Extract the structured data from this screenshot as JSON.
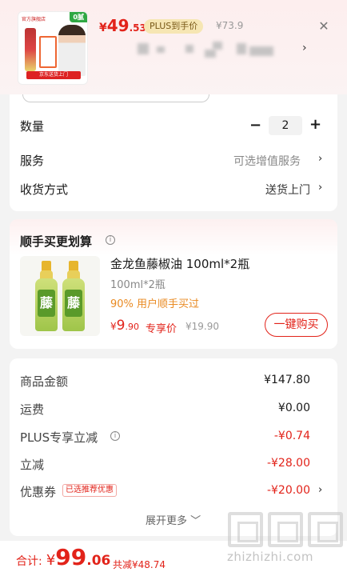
{
  "header": {
    "thumb_store_label": "官方旗舰店",
    "thumb_badge": "0腻",
    "thumb_footer": "京东送货上门",
    "price_yen": "¥",
    "price_int": "49",
    "price_dec": ".53",
    "plus_tag": "PLUS到手价",
    "orig_price": "¥73.9",
    "close_icon": "close-icon",
    "spec_chevron": "›"
  },
  "rows": {
    "quantity_label": "数量",
    "quantity_minus": "−",
    "quantity_value": "2",
    "quantity_plus": "+",
    "service_label": "服务",
    "service_value": "可选增值服务",
    "shipping_label": "收货方式",
    "shipping_value": "送货上门",
    "chevron": "›"
  },
  "bundle": {
    "title": "顺手买更划算",
    "info": "i",
    "product_name": "金龙鱼藤椒油 100ml*2瓶",
    "spec": "100ml*2瓶",
    "pct": "90% 用户顺手买过",
    "price_yen": "¥",
    "price_int": "9",
    "price_dec": ".90",
    "exclusive_label": "专享价",
    "orig_price": "¥19.90",
    "bottle_label": "藤",
    "buy_button": "一键购买"
  },
  "cost": {
    "items": [
      {
        "label": "商品金额",
        "value": "¥147.80"
      },
      {
        "label": "运费",
        "value": "¥0.00"
      },
      {
        "label": "PLUS专享立减",
        "value": "-¥0.74"
      },
      {
        "label": "立减",
        "value": "-¥28.00"
      },
      {
        "label": "优惠券",
        "value": "-¥20.00"
      }
    ],
    "coupon_tag": "已选推荐优惠",
    "expand": "展开更多 ﹀"
  },
  "footer": {
    "total_label": "合计:",
    "total_yen": "¥",
    "total_int": "99",
    "total_dec": ".06",
    "discount": "共减¥48.74"
  },
  "watermark": {
    "text": "zhizhizhi.com"
  },
  "colors": {
    "accent": "#e2231a",
    "plus_bg": "#f6e6b3",
    "orange": "#e98a22"
  }
}
